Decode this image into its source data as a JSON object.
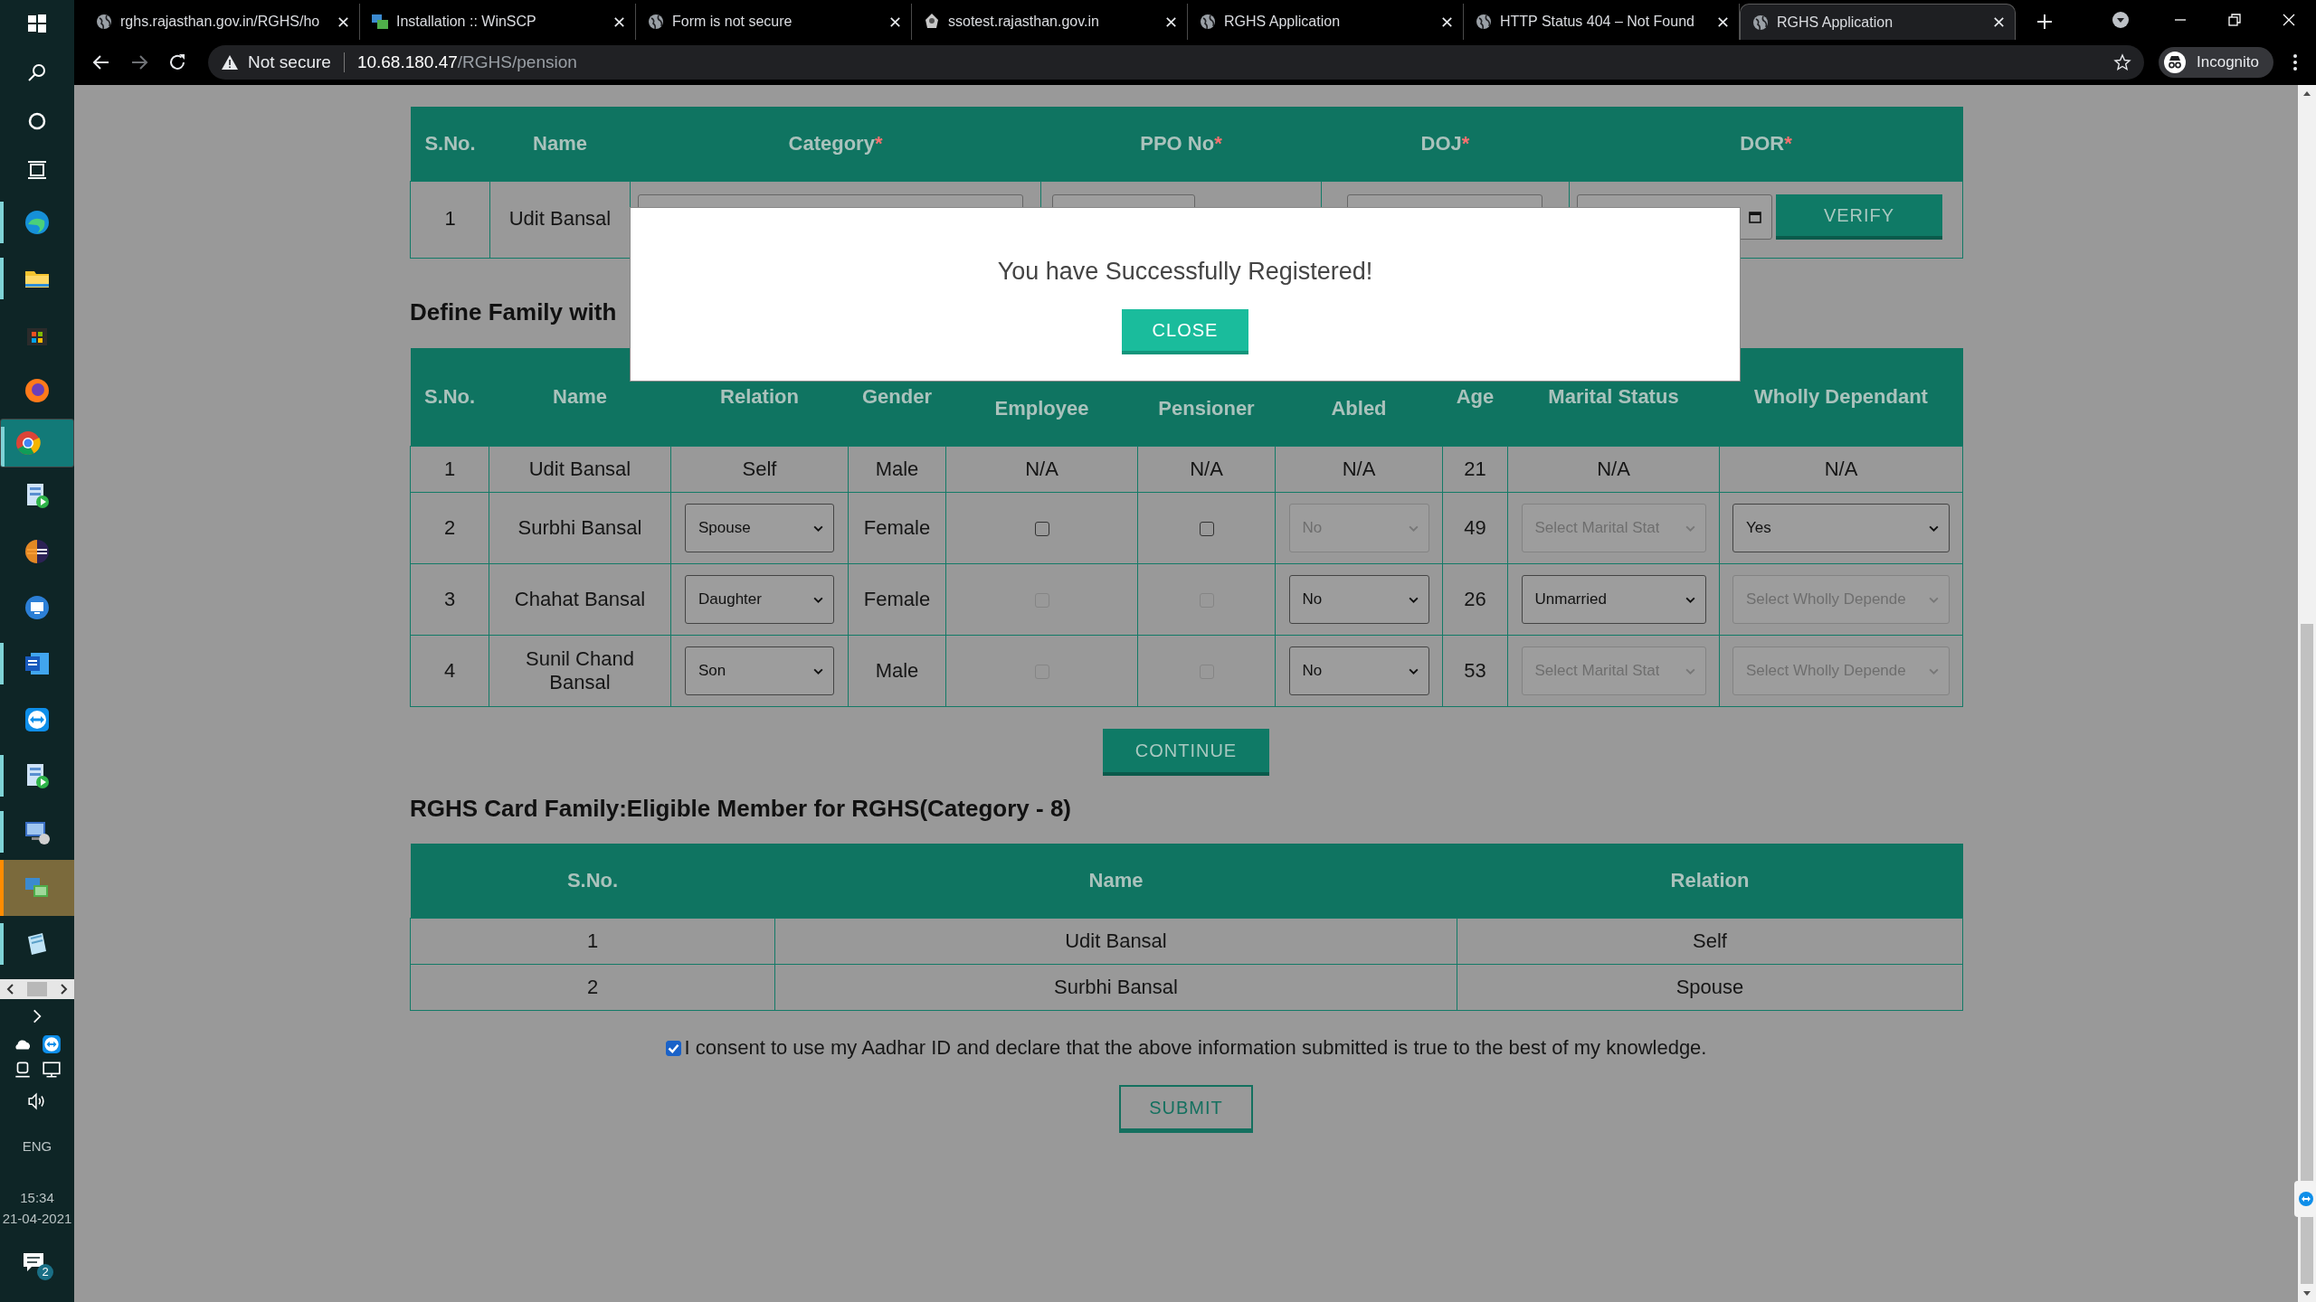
{
  "taskbar": {
    "apps": [
      {
        "kind": "edge",
        "running": true,
        "selected": false,
        "attention": false
      },
      {
        "kind": "files",
        "running": true,
        "selected": false,
        "attention": false
      },
      {
        "kind": "store",
        "running": false,
        "selected": false,
        "attention": false
      },
      {
        "kind": "firefox",
        "running": false,
        "selected": false,
        "attention": false
      },
      {
        "kind": "chrome",
        "running": true,
        "selected": true,
        "attention": false
      },
      {
        "kind": "server",
        "running": false,
        "selected": false,
        "attention": false
      },
      {
        "kind": "eclipse",
        "running": false,
        "selected": false,
        "attention": false
      },
      {
        "kind": "remote",
        "running": false,
        "selected": false,
        "attention": false
      },
      {
        "kind": "word",
        "running": true,
        "selected": false,
        "attention": false
      },
      {
        "kind": "teamviewer",
        "running": false,
        "selected": false,
        "attention": false
      },
      {
        "kind": "server",
        "running": true,
        "selected": false,
        "attention": false
      },
      {
        "kind": "network",
        "running": true,
        "selected": false,
        "attention": false
      },
      {
        "kind": "winscp",
        "running": true,
        "selected": false,
        "attention": true
      },
      {
        "kind": "notepad",
        "running": true,
        "selected": false,
        "attention": false
      }
    ],
    "language": "ENG",
    "time": "15:34",
    "date": "21-04-2021",
    "notification_count": "2"
  },
  "browser": {
    "tabs": [
      {
        "title": "rghs.rajasthan.gov.in/RGHS/ho",
        "kind": "globe",
        "selected": false
      },
      {
        "title": "Installation :: WinSCP",
        "kind": "winscp",
        "selected": false
      },
      {
        "title": "Form is not secure",
        "kind": "globe",
        "selected": false
      },
      {
        "title": "ssotest.rajasthan.gov.in",
        "kind": "emblem",
        "selected": false
      },
      {
        "title": "RGHS Application",
        "kind": "globe",
        "selected": false
      },
      {
        "title": "HTTP Status 404 – Not Found",
        "kind": "globe",
        "selected": false
      },
      {
        "title": "RGHS Application",
        "kind": "globe",
        "selected": true
      }
    ],
    "security_label": "Not secure",
    "url": {
      "host": "10.68.180.47",
      "path": "/RGHS/pension"
    },
    "profile_label": "Incognito"
  },
  "service_table": {
    "columns": [
      {
        "label": "S.No."
      },
      {
        "label": "Name"
      },
      {
        "label": "Category",
        "mark": "*"
      },
      {
        "label": "PPO No",
        "mark": "*"
      },
      {
        "label": "DOJ",
        "mark": "*"
      },
      {
        "label": "DOR",
        "mark": "*"
      }
    ],
    "rows": [
      {
        "sno": "1",
        "name": "Udit Bansal"
      }
    ],
    "verify_button": "VERIFY"
  },
  "family_section": {
    "heading": "Define Family with",
    "columns": [
      {
        "label": "S.No.",
        "lower": false
      },
      {
        "label": "Name",
        "lower": false
      },
      {
        "label": "Relation",
        "lower": false
      },
      {
        "label": "Gender",
        "lower": false
      },
      {
        "label": "Employee",
        "lower": true
      },
      {
        "label": "Pensioner",
        "lower": true
      },
      {
        "label": "Abled",
        "lower": true
      },
      {
        "label": "Age",
        "lower": false
      },
      {
        "label": "Marital Status",
        "lower": false
      },
      {
        "label": "Wholly Dependant",
        "lower": false
      }
    ],
    "rows": [
      {
        "cells": [
          {
            "kind": "text",
            "text": "1"
          },
          {
            "kind": "text",
            "text": "Udit Bansal"
          },
          {
            "kind": "text",
            "text": "Self"
          },
          {
            "kind": "text",
            "text": "Male"
          },
          {
            "kind": "text",
            "text": "N/A"
          },
          {
            "kind": "text",
            "text": "N/A"
          },
          {
            "kind": "text",
            "text": "N/A"
          },
          {
            "kind": "text",
            "text": "21"
          },
          {
            "kind": "text",
            "text": "N/A"
          },
          {
            "kind": "text",
            "text": "N/A"
          }
        ]
      },
      {
        "cells": [
          {
            "kind": "text",
            "text": "2"
          },
          {
            "kind": "text",
            "text": "Surbhi Bansal"
          },
          {
            "kind": "select",
            "value": "Spouse",
            "disabled": false
          },
          {
            "kind": "text",
            "text": "Female"
          },
          {
            "kind": "checkbox",
            "checked": false,
            "disabled": false
          },
          {
            "kind": "checkbox",
            "checked": false,
            "disabled": false
          },
          {
            "kind": "select",
            "value": "No",
            "disabled": true
          },
          {
            "kind": "text",
            "text": "49"
          },
          {
            "kind": "select",
            "value": "Select Marital Stat",
            "disabled": true
          },
          {
            "kind": "select",
            "value": "Yes",
            "disabled": false
          }
        ]
      },
      {
        "cells": [
          {
            "kind": "text",
            "text": "3"
          },
          {
            "kind": "text",
            "text": "Chahat Bansal"
          },
          {
            "kind": "select",
            "value": "Daughter",
            "disabled": false
          },
          {
            "kind": "text",
            "text": "Female"
          },
          {
            "kind": "checkbox",
            "checked": false,
            "disabled": true
          },
          {
            "kind": "checkbox",
            "checked": false,
            "disabled": true
          },
          {
            "kind": "select",
            "value": "No",
            "disabled": false
          },
          {
            "kind": "text",
            "text": "26"
          },
          {
            "kind": "select",
            "value": "Unmarried",
            "disabled": false
          },
          {
            "kind": "select",
            "value": "Select Wholly Depende",
            "disabled": true
          }
        ]
      },
      {
        "cells": [
          {
            "kind": "text",
            "text": "4"
          },
          {
            "kind": "text",
            "text": "Sunil Chand Bansal"
          },
          {
            "kind": "select",
            "value": "Son",
            "disabled": false
          },
          {
            "kind": "text",
            "text": "Male"
          },
          {
            "kind": "checkbox",
            "checked": false,
            "disabled": true
          },
          {
            "kind": "checkbox",
            "checked": false,
            "disabled": true
          },
          {
            "kind": "select",
            "value": "No",
            "disabled": false
          },
          {
            "kind": "text",
            "text": "53"
          },
          {
            "kind": "select",
            "value": "Select Marital Stat",
            "disabled": true
          },
          {
            "kind": "select",
            "value": "Select Wholly Depende",
            "disabled": true
          }
        ]
      }
    ],
    "continue_button": "CONTINUE"
  },
  "eligible_section": {
    "heading": "RGHS Card Family:Eligible Member for RGHS(Category - 8)",
    "columns": [
      "S.No.",
      "Name",
      "Relation"
    ],
    "rows": [
      [
        "1",
        "Udit Bansal",
        "Self"
      ],
      [
        "2",
        "Surbhi Bansal",
        "Spouse"
      ]
    ]
  },
  "consent": {
    "checked": true,
    "text": "I consent to use my Aadhar ID and declare that the above information submitted is true to the best of my knowledge."
  },
  "submit_button": "SUBMIT",
  "modal": {
    "message": "You have Successfully Registered!",
    "close_button": "CLOSE"
  }
}
